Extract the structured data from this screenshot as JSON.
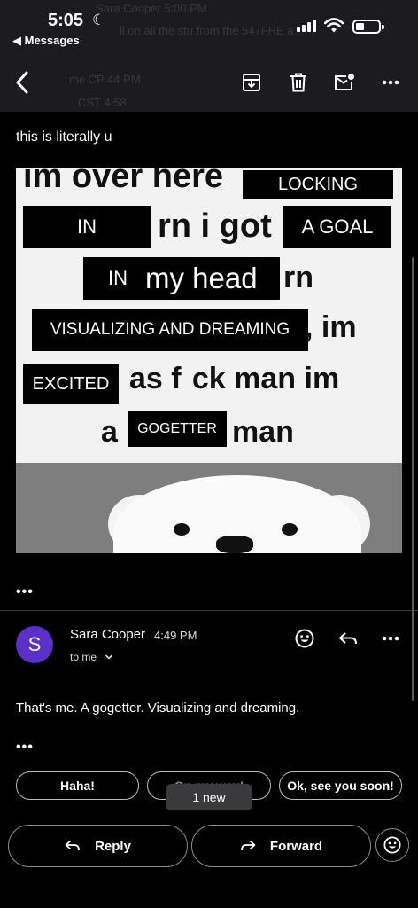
{
  "status_bar": {
    "time": "5:05",
    "back_app": "◀ Messages",
    "ghost_line_1": "Sara Cooper 5:00 PM",
    "ghost_line_2": "ll on all the stu from the 547FHE a",
    "ghost_line_3": "me CP 44 PM",
    "ghost_line_4": "CST 4:58"
  },
  "email": {
    "first_message": "this is literally u",
    "meme": {
      "line1_text": "im over here",
      "locking": "LOCKING",
      "in1": "IN",
      "rn_i_got": "rn i got",
      "a_goal": "A GOAL",
      "in2": "IN",
      "my_head": "my head",
      "rn": "rn",
      "visualizing": "VISUALIZING AND DREAMING",
      "im": ", im",
      "excited": "EXCITED",
      "as_fuck": "as f  ck man im",
      "a": "a",
      "gogetter": "GOGETTER",
      "man": "man"
    },
    "trimmed_dots_1": "•••",
    "sender": "Sara Cooper",
    "time": "4:49 PM",
    "to": "to me",
    "reply_text": "That's me.  A gogetter. Visualizing and dreaming.",
    "trimmed_dots_2": "•••"
  },
  "smart_replies": [
    "Haha!",
    "On my way!",
    "Ok, see you soon!"
  ],
  "toast": "1 new",
  "actions": {
    "reply": "Reply",
    "forward": "Forward"
  },
  "colors": {
    "avatar": "#5b2fc9",
    "toolbar_bg": "#1c1c1e"
  }
}
